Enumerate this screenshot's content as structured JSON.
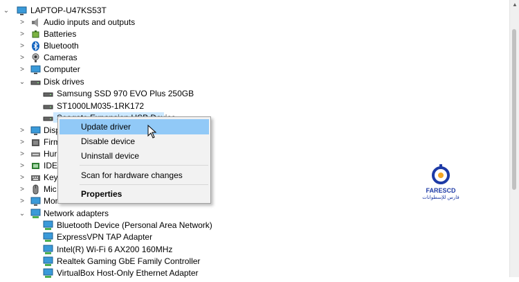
{
  "device_tree": {
    "root": {
      "label": "LAPTOP-U47KS53T",
      "icon": "computer-icon"
    },
    "categories": [
      {
        "label": "Audio inputs and outputs",
        "icon": "speaker-icon",
        "expanded": false
      },
      {
        "label": "Batteries",
        "icon": "battery-icon",
        "expanded": false
      },
      {
        "label": "Bluetooth",
        "icon": "bluetooth-icon",
        "expanded": false
      },
      {
        "label": "Cameras",
        "icon": "camera-icon",
        "expanded": false
      },
      {
        "label": "Computer",
        "icon": "monitor-icon",
        "expanded": false
      },
      {
        "label": "Disk drives",
        "icon": "disk-drive-icon",
        "expanded": true
      },
      {
        "label": "Samsung SSD 970 EVO Plus 250GB",
        "icon": "disk-drive-icon"
      },
      {
        "label": "ST1000LM035-1RK172",
        "icon": "disk-drive-icon"
      },
      {
        "label": "Seagate Expansion USB Device",
        "icon": "disk-drive-icon",
        "selected": true
      },
      {
        "label": "Disp",
        "icon": "display-adapter-icon",
        "expanded": false
      },
      {
        "label": "Firm",
        "icon": "firmware-icon",
        "expanded": false
      },
      {
        "label": "Hur",
        "icon": "hid-icon",
        "expanded": false
      },
      {
        "label": "IDE",
        "icon": "ide-controller-icon",
        "expanded": false
      },
      {
        "label": "Key",
        "icon": "keyboard-icon",
        "expanded": false
      },
      {
        "label": "Mic",
        "icon": "mouse-icon",
        "expanded": false
      },
      {
        "label": "Monitors",
        "icon": "monitor-icon",
        "expanded": false
      },
      {
        "label": "Network adapters",
        "icon": "network-adapter-icon",
        "expanded": true
      },
      {
        "label": "Bluetooth Device (Personal Area Network)",
        "icon": "network-adapter-icon"
      },
      {
        "label": "ExpressVPN TAP Adapter",
        "icon": "network-adapter-icon"
      },
      {
        "label": "Intel(R) Wi-Fi 6 AX200 160MHz",
        "icon": "network-adapter-icon"
      },
      {
        "label": "Realtek Gaming GbE Family Controller",
        "icon": "network-adapter-icon"
      },
      {
        "label": "VirtualBox Host-Only Ethernet Adapter",
        "icon": "network-adapter-icon"
      }
    ]
  },
  "context_menu": {
    "update_driver": "Update driver",
    "disable_device": "Disable device",
    "uninstall_device": "Uninstall device",
    "scan": "Scan for hardware changes",
    "properties": "Properties"
  },
  "watermark": {
    "brand": "FARESCD",
    "arabic": "فارس للإسطوانات"
  },
  "colors": {
    "selection": "#cce8ff",
    "menu_hover": "#91c9f7",
    "menu_bg": "#f2f2f2",
    "brand": "#1d3aa6"
  }
}
